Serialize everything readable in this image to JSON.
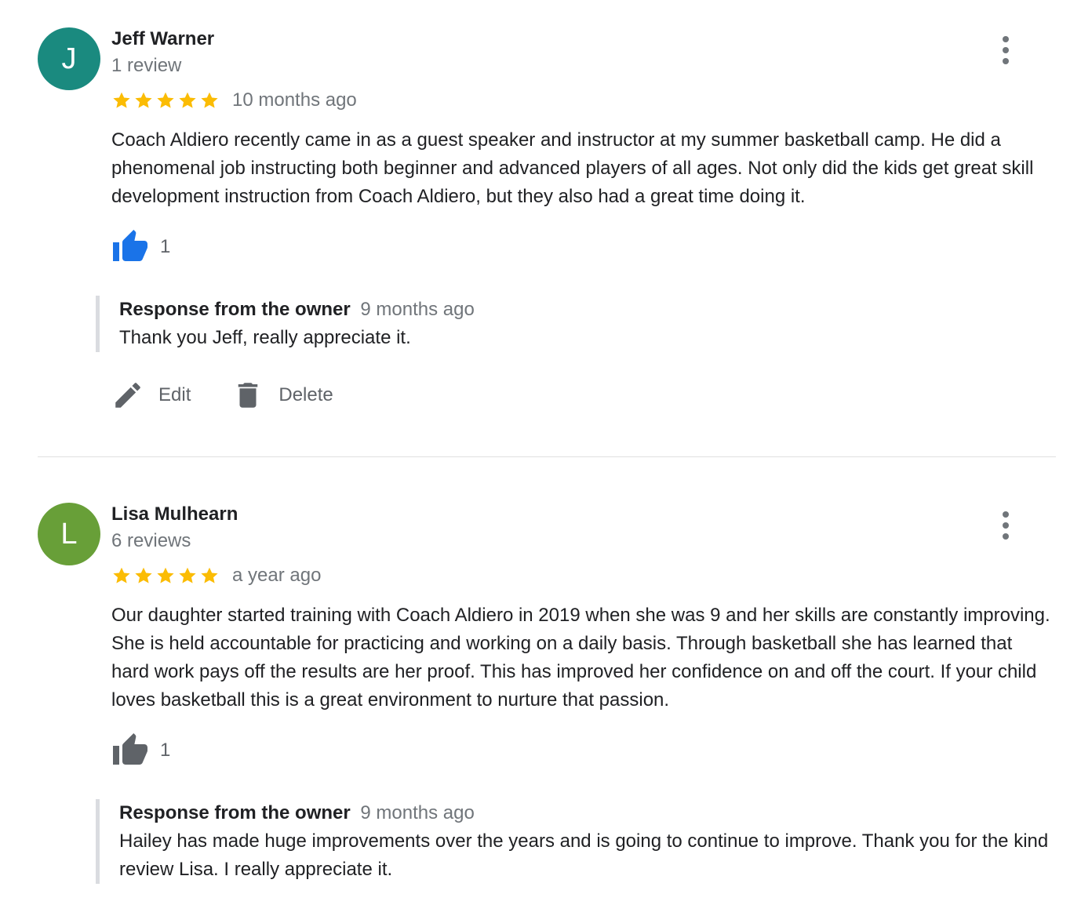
{
  "colors": {
    "avatar_1": "#1a8a7f",
    "avatar_2": "#689f38",
    "star": "#fbbc04",
    "like_active": "#1a73e8",
    "like_inactive": "#5f6368"
  },
  "reviews": [
    {
      "initial": "J",
      "name": "Jeff Warner",
      "review_count": "1 review",
      "rating": 5,
      "time": "10 months ago",
      "text": "Coach Aldiero recently came in as a guest speaker and instructor at my summer basketball camp. He did a phenomenal job instructing both beginner and advanced players of all ages. Not only did the kids get great skill development instruction from Coach Aldiero, but they also had a great time doing it.",
      "likes": "1",
      "liked": true,
      "response": {
        "title": "Response from the owner",
        "time": "9 months ago",
        "text": "Thank you Jeff, really appreciate it."
      },
      "actions": {
        "edit": "Edit",
        "delete": "Delete"
      }
    },
    {
      "initial": "L",
      "name": "Lisa Mulhearn",
      "review_count": "6 reviews",
      "rating": 5,
      "time": "a year ago",
      "text": "Our daughter started training with Coach Aldiero in 2019 when she was 9 and her skills are constantly improving. She is held accountable for practicing and working on a daily basis. Through basketball she has learned that hard work pays off the results are her proof. This has improved her confidence on and off the court. If your child loves basketball this is a great environment to nurture that passion.",
      "likes": "1",
      "liked": false,
      "response": {
        "title": "Response from the owner",
        "time": "9 months ago",
        "text": "Hailey has made huge improvements over the years and is going to continue to improve. Thank you for the kind review Lisa. I really appreciate it."
      }
    }
  ]
}
